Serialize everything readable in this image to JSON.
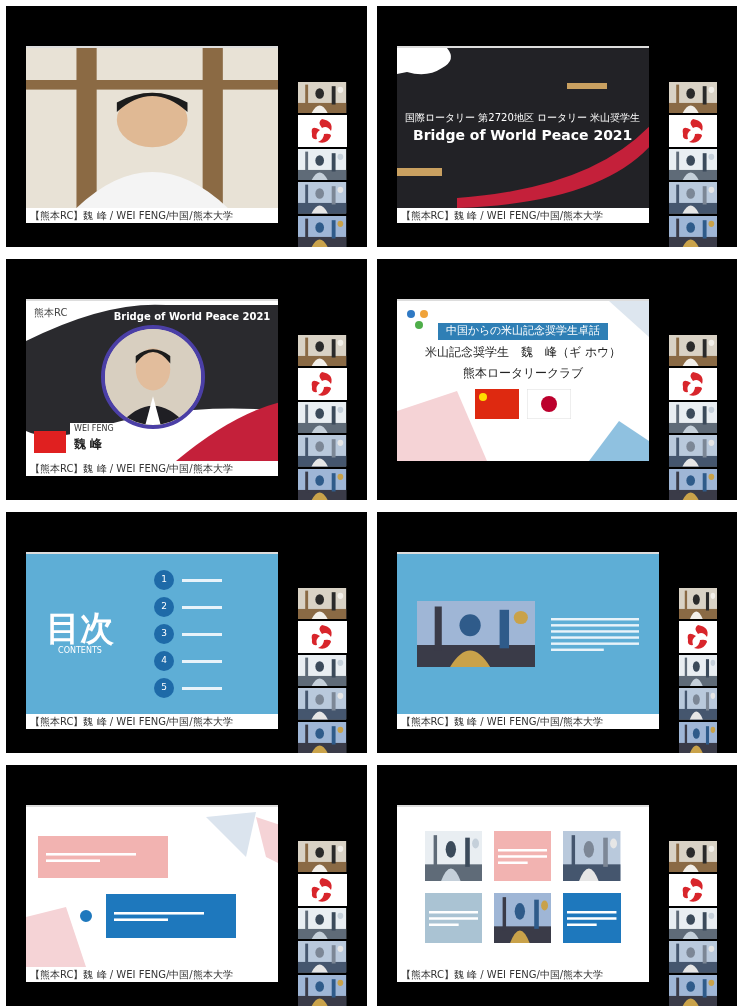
{
  "panels": [
    {
      "kind": "camera",
      "caption": "【熊本RC】魏 峰 / WEI FENG/中国/熊本大学"
    },
    {
      "kind": "title_slide",
      "subtitle": "国際ロータリー 第2720地区 ロータリー 米山奨学生",
      "title": "Bridge of World Peace 2021",
      "caption": "【熊本RC】魏 峰 / WEI FENG/中国/熊本大学"
    },
    {
      "kind": "profile_slide",
      "club": "熊本RC",
      "title": "Bridge of World Peace 2021",
      "name_latin": "WEI FENG",
      "name": "魏 峰",
      "caption": "【熊本RC】魏 峰 / WEI FENG/中国/熊本大学"
    },
    {
      "kind": "cover_slide",
      "title": "中国からの米山記念奨学生卓話",
      "name_line": "米山記念奨学生　魏　峰（ギ ホウ）",
      "club_line": "熊本ロータリークラブ"
    },
    {
      "kind": "toc_slide",
      "title": "目次",
      "subtitle": "CONTENTS",
      "numbers": [
        "1",
        "2",
        "3",
        "4",
        "5"
      ],
      "caption": "【熊本RC】魏 峰 / WEI FENG/中国/熊本大学"
    },
    {
      "kind": "photo_slide",
      "caption": "【熊本RC】魏 峰 / WEI FENG/中国/熊本大学"
    },
    {
      "kind": "timeline_slide",
      "caption": "【熊本RC】魏 峰 / WEI FENG/中国/熊本大学"
    },
    {
      "kind": "gallery_slide",
      "caption": "【熊本RC】魏 峰 / WEI FENG/中国/熊本大学"
    }
  ]
}
